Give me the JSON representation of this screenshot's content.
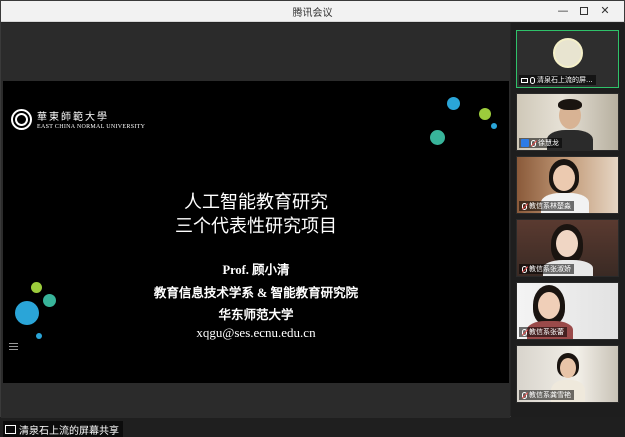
{
  "window": {
    "title": "腾讯会议",
    "min_glyph": "—",
    "close_glyph": "✕"
  },
  "slide": {
    "logo_cn": "華東師範大學",
    "logo_en": "EAST CHINA NORMAL UNIVERSITY",
    "title_line1": "人工智能教育研究",
    "title_line2": "三个代表性研究项目",
    "author": "Prof. 顾小清",
    "department": "教育信息技术学系 & 智能教育研究院",
    "university": "华东师范大学",
    "email": "xqgu@ses.ecnu.edu.cn"
  },
  "share": {
    "label": "清泉石上流的屏幕共享"
  },
  "participants": [
    {
      "name": "清泉石上流的屏...",
      "icons": [
        "screen-icon",
        "mic-icon"
      ],
      "active": true
    },
    {
      "name": "徐慧龙",
      "icons": [
        "user-icon",
        "mic-off-icon"
      ],
      "active": false
    },
    {
      "name": "教信系林楚淼",
      "icons": [
        "mic-off-icon"
      ],
      "active": false
    },
    {
      "name": "教信系张淑娇",
      "icons": [
        "mic-off-icon"
      ],
      "active": false
    },
    {
      "name": "教信系张蕾",
      "icons": [
        "mic-off-icon"
      ],
      "active": false
    },
    {
      "name": "教信系龚雪艳",
      "icons": [
        "mic-off-icon"
      ],
      "active": false
    }
  ],
  "colors": {
    "accent_active": "#2fc26a",
    "dot_blue": "#2aa5d8",
    "dot_green": "#38b49a",
    "dot_lime": "#9ccc3c",
    "mic_muted": "#e64a4a"
  }
}
